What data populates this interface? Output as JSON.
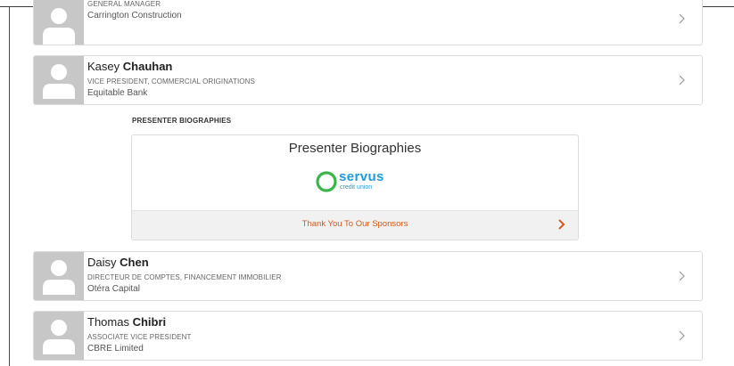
{
  "presenters": [
    {
      "first_name": "",
      "last_name": "",
      "title": "GENERAL MANAGER",
      "company": "Carrington Construction"
    },
    {
      "first_name": "Kasey",
      "last_name": "Chauhan",
      "title": "VICE PRESIDENT, COMMERCIAL ORIGINATIONS",
      "company": "Equitable Bank"
    },
    {
      "first_name": "Daisy",
      "last_name": "Chen",
      "title": "DIRECTEUR DE COMPTES, FINANCEMENT IMMOBILIER",
      "company": "Otéra Capital"
    },
    {
      "first_name": "Thomas",
      "last_name": "Chibri",
      "title": "ASSOCIATE VICE PRESIDENT",
      "company": "CBRE Limited"
    }
  ],
  "bio_section": {
    "label": "PRESENTER BIOGRAPHIES",
    "box_title": "Presenter Biographies",
    "logo_word": "servus",
    "logo_sub": "credit union",
    "sponsor_link": "Thank You To Our Sponsors"
  },
  "colors": {
    "accent": "#d45a1a",
    "logo_green": "#3ab54a",
    "logo_blue": "#1f9bd7",
    "avatar_bg": "#c7c7c7"
  },
  "icons": {
    "avatar": "person-silhouette-icon",
    "row_chevron": "chevron-right-icon",
    "sponsor_chevron": "chevron-right-icon"
  }
}
